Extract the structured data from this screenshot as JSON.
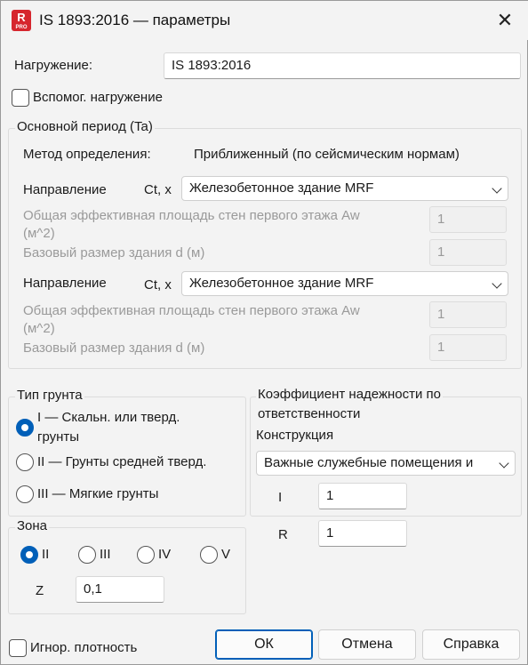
{
  "window": {
    "title": "IS 1893:2016 — параметры",
    "app_icon_letter": "R",
    "app_icon_badge": "PRO",
    "close_glyph": "✕"
  },
  "load": {
    "label": "Нагружение:",
    "value": "IS 1893:2016",
    "aux_label": "Вспомог. нагружение",
    "aux_checked": false
  },
  "period": {
    "group_label": "Основной период (Ta)",
    "method_label": "Метод определения:",
    "method_value": "Приближенный (по сейсмическим нормам)",
    "dir1": {
      "label": "Направление",
      "axis": "Ct, x",
      "selected": "Железобетонное здание MRF",
      "area_label_1": "Общая эффективная площадь стен первого этажа Aw",
      "area_label_2": "(м^2)",
      "area_value": "1",
      "size_label": "Базовый размер здания d (м)",
      "size_value": "1"
    },
    "dir2": {
      "label": "Направление",
      "axis": "Ct, x",
      "selected": "Железобетонное здание MRF",
      "area_label_1": "Общая эффективная площадь стен первого этажа Aw",
      "area_label_2": "(м^2)",
      "area_value": "1",
      "size_label": "Базовый размер здания d (м)",
      "size_value": "1"
    }
  },
  "soil": {
    "group_label": "Тип грунта",
    "options": [
      {
        "label_1": "I — Скальн. или тверд.",
        "label_2": "грунты",
        "selected": true
      },
      {
        "label": "II — Грунты средней тверд.",
        "selected": false
      },
      {
        "label": "III — Мягкие грунты",
        "selected": false
      }
    ]
  },
  "zone": {
    "group_label": "Зона",
    "options": [
      {
        "label": "II",
        "selected": true
      },
      {
        "label": "III",
        "selected": false
      },
      {
        "label": "IV",
        "selected": false
      },
      {
        "label": "V",
        "selected": false
      }
    ],
    "z_label": "Z",
    "z_value": "0,1"
  },
  "importance": {
    "group_label_1": "Коэффициент надежности по",
    "group_label_2": "ответственности",
    "construction_label": "Конструкция",
    "construction_selected": "Важные служебные помещения и",
    "i_label": "I",
    "i_value": "1",
    "r_label": "R",
    "r_value": "1"
  },
  "footer": {
    "ignore_density_label": "Игнор. плотность",
    "ignore_density_checked": false,
    "ok_label": "ОК",
    "cancel_label": "Отмена",
    "help_label": "Справка"
  },
  "colors": {
    "accent": "#005fb8",
    "app_icon": "#d6262e",
    "background": "#f3f3f3",
    "disabled_text": "#9a9a9a"
  }
}
